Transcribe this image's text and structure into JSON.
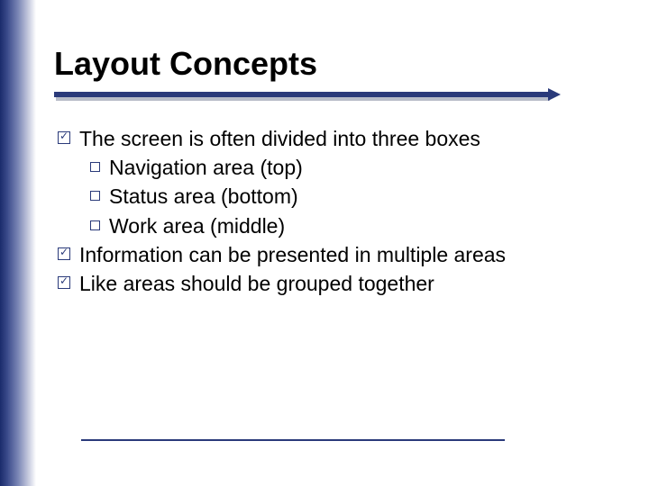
{
  "title": "Layout Concepts",
  "bullets": [
    {
      "level": 1,
      "text": "The screen is often divided into three boxes"
    },
    {
      "level": 2,
      "text": "Navigation area (top)"
    },
    {
      "level": 2,
      "text": "Status area (bottom)"
    },
    {
      "level": 2,
      "text": "Work area (middle)"
    },
    {
      "level": 1,
      "text": "Information can be presented in multiple areas"
    },
    {
      "level": 1,
      "text": "Like areas should be grouped together"
    }
  ]
}
